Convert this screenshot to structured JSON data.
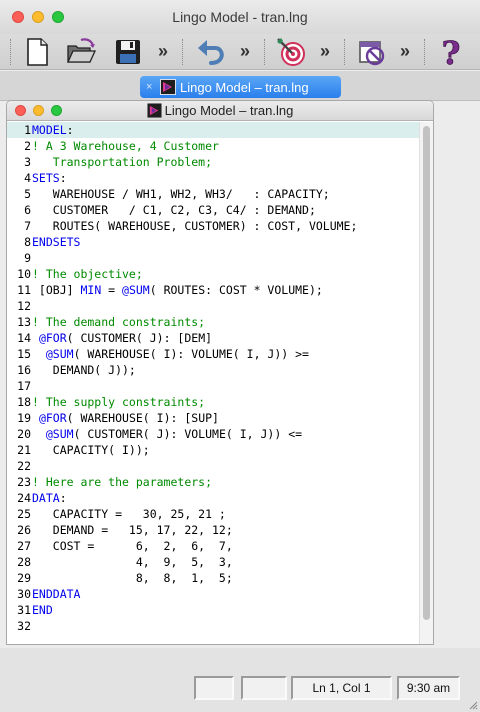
{
  "window": {
    "title": "Lingo Model - tran.lng"
  },
  "toolbar": {
    "buttons": [
      {
        "icon": "new-document-icon"
      },
      {
        "icon": "open-folder-icon"
      },
      {
        "icon": "save-disk-icon"
      },
      {
        "icon": "undo-arrow-icon"
      },
      {
        "icon": "solve-target-icon"
      },
      {
        "icon": "options-icon"
      },
      {
        "icon": "help-question-icon"
      }
    ],
    "overflow_glyph": "»"
  },
  "tab": {
    "label": "Lingo Model – tran.lng",
    "close_glyph": "×"
  },
  "editor": {
    "title": "Lingo Model – tran.lng",
    "lines": [
      {
        "n": "1",
        "parts": [
          {
            "t": "MODEL",
            "c": "kw"
          },
          {
            "t": ":",
            "c": ""
          }
        ]
      },
      {
        "n": "2",
        "parts": [
          {
            "t": "! A 3 Warehouse, 4 Customer",
            "c": "cm"
          }
        ]
      },
      {
        "n": "3",
        "parts": [
          {
            "t": "   Transportation Problem;",
            "c": "cm"
          }
        ]
      },
      {
        "n": "4",
        "parts": [
          {
            "t": "SETS",
            "c": "kw"
          },
          {
            "t": ":",
            "c": ""
          }
        ]
      },
      {
        "n": "5",
        "parts": [
          {
            "t": "   WAREHOUSE / WH1, WH2, WH3/   : CAPACITY;",
            "c": ""
          }
        ]
      },
      {
        "n": "6",
        "parts": [
          {
            "t": "   CUSTOMER   / C1, C2, C3, C4/ : DEMAND;",
            "c": ""
          }
        ]
      },
      {
        "n": "7",
        "parts": [
          {
            "t": "   ROUTES( WAREHOUSE, CUSTOMER) : COST, VOLUME;",
            "c": ""
          }
        ]
      },
      {
        "n": "8",
        "parts": [
          {
            "t": "ENDSETS",
            "c": "kw"
          }
        ]
      },
      {
        "n": "9",
        "parts": [
          {
            "t": "",
            "c": ""
          }
        ]
      },
      {
        "n": "10",
        "parts": [
          {
            "t": "! The objective;",
            "c": "cm"
          }
        ]
      },
      {
        "n": "11",
        "parts": [
          {
            "t": " [OBJ] ",
            "c": ""
          },
          {
            "t": "MIN",
            "c": "kw"
          },
          {
            "t": " = ",
            "c": ""
          },
          {
            "t": "@SUM",
            "c": "kw"
          },
          {
            "t": "( ROUTES: COST * VOLUME);",
            "c": ""
          }
        ]
      },
      {
        "n": "12",
        "parts": [
          {
            "t": "",
            "c": ""
          }
        ]
      },
      {
        "n": "13",
        "parts": [
          {
            "t": "! The demand constraints;",
            "c": "cm"
          }
        ]
      },
      {
        "n": "14",
        "parts": [
          {
            "t": " ",
            "c": ""
          },
          {
            "t": "@FOR",
            "c": "kw"
          },
          {
            "t": "( CUSTOMER( J): [DEM]",
            "c": ""
          }
        ]
      },
      {
        "n": "15",
        "parts": [
          {
            "t": "  ",
            "c": ""
          },
          {
            "t": "@SUM",
            "c": "kw"
          },
          {
            "t": "( WAREHOUSE( I): VOLUME( I, J)) >=",
            "c": ""
          }
        ]
      },
      {
        "n": "16",
        "parts": [
          {
            "t": "   DEMAND( J));",
            "c": ""
          }
        ]
      },
      {
        "n": "17",
        "parts": [
          {
            "t": "",
            "c": ""
          }
        ]
      },
      {
        "n": "18",
        "parts": [
          {
            "t": "! The supply constraints;",
            "c": "cm"
          }
        ]
      },
      {
        "n": "19",
        "parts": [
          {
            "t": " ",
            "c": ""
          },
          {
            "t": "@FOR",
            "c": "kw"
          },
          {
            "t": "( WAREHOUSE( I): [SUP]",
            "c": ""
          }
        ]
      },
      {
        "n": "20",
        "parts": [
          {
            "t": "  ",
            "c": ""
          },
          {
            "t": "@SUM",
            "c": "kw"
          },
          {
            "t": "( CUSTOMER( J): VOLUME( I, J)) <=",
            "c": ""
          }
        ]
      },
      {
        "n": "21",
        "parts": [
          {
            "t": "   CAPACITY( I));",
            "c": ""
          }
        ]
      },
      {
        "n": "22",
        "parts": [
          {
            "t": "",
            "c": ""
          }
        ]
      },
      {
        "n": "23",
        "parts": [
          {
            "t": "! Here are the parameters;",
            "c": "cm"
          }
        ]
      },
      {
        "n": "24",
        "parts": [
          {
            "t": "DATA",
            "c": "kw"
          },
          {
            "t": ":",
            "c": ""
          }
        ]
      },
      {
        "n": "25",
        "parts": [
          {
            "t": "   CAPACITY =   30, 25, 21 ;",
            "c": ""
          }
        ]
      },
      {
        "n": "26",
        "parts": [
          {
            "t": "   DEMAND =   15, 17, 22, 12;",
            "c": ""
          }
        ]
      },
      {
        "n": "27",
        "parts": [
          {
            "t": "   COST =      6,  2,  6,  7,",
            "c": ""
          }
        ]
      },
      {
        "n": "28",
        "parts": [
          {
            "t": "               4,  9,  5,  3,",
            "c": ""
          }
        ]
      },
      {
        "n": "29",
        "parts": [
          {
            "t": "               8,  8,  1,  5;",
            "c": ""
          }
        ]
      },
      {
        "n": "30",
        "parts": [
          {
            "t": "ENDDATA",
            "c": "kw"
          }
        ]
      },
      {
        "n": "31",
        "parts": [
          {
            "t": "END",
            "c": "kw"
          }
        ]
      },
      {
        "n": "32",
        "parts": [
          {
            "t": "",
            "c": ""
          }
        ]
      }
    ]
  },
  "status": {
    "pane1": "",
    "pane2": "",
    "position": "Ln 1, Col 1",
    "time": "9:30 am"
  },
  "colors": {
    "keyword": "#0000ee",
    "comment": "#008a00",
    "current_line": "#dbeeee",
    "tab_active": "#2a7fec"
  }
}
